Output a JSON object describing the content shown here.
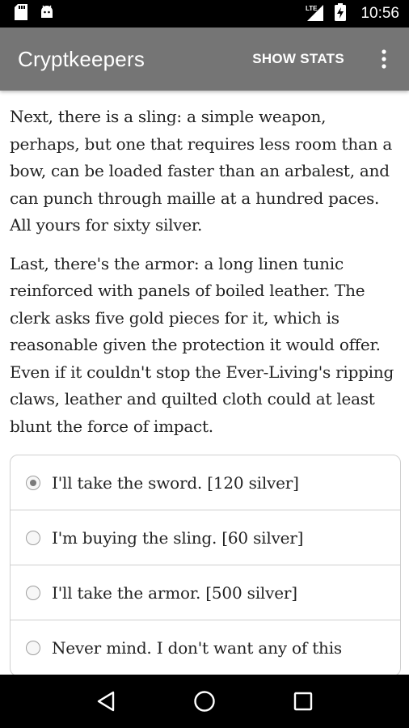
{
  "status_bar": {
    "time": "10:56",
    "network_label": "LTE",
    "icons": [
      "sd-card-icon",
      "android-icon",
      "lte-signal-icon",
      "battery-charging-icon"
    ]
  },
  "app_bar": {
    "title": "Cryptkeepers",
    "show_stats_label": "SHOW STATS",
    "overflow_icon": "more-vert-icon",
    "background_color": "#757575"
  },
  "story": {
    "paragraphs": [
      "Next, there is a sling: a simple weapon, perhaps, but one that requires less room than a bow, can be loaded faster than an arbalest, and can punch through maille at a hundred paces. All yours for sixty silver.",
      "Last, there's the armor: a long linen tunic reinforced with panels of boiled leather. The clerk asks five gold pieces for it, which is reasonable given the protection it would offer. Even if it couldn't stop the Ever-Living's ripping claws, leather and quilted cloth could at least blunt the force of impact."
    ]
  },
  "choices": [
    {
      "label": "I'll take the sword. [120 silver]",
      "selected": true
    },
    {
      "label": "I'm buying the sling. [60 silver]",
      "selected": false
    },
    {
      "label": "I'll take the armor. [500 silver]",
      "selected": false
    },
    {
      "label": "Never mind. I don't want any of this",
      "selected": false
    }
  ],
  "nav_bar": {
    "buttons": [
      "back-icon",
      "home-icon",
      "recents-icon"
    ]
  }
}
